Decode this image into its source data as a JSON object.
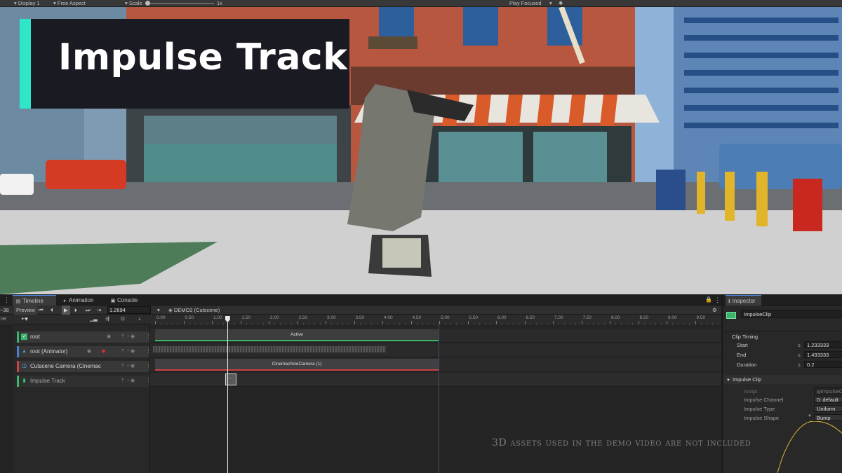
{
  "game_toolbar": {
    "display": "Display 1",
    "aspect": "Free Aspect",
    "scale_label": "Scale",
    "scale_value": "1x",
    "play_mode": "Play Focused"
  },
  "overlay": {
    "title": "Impulse Track",
    "accent_color": "#2fe6c8",
    "watermark": "3D assets used in the demo video are not included"
  },
  "panels": {
    "tabs": [
      {
        "label": "Timeline",
        "icon": "timeline-icon"
      },
      {
        "label": "Animation",
        "icon": "animation-icon"
      },
      {
        "label": "Console",
        "icon": "console-icon"
      }
    ],
    "inspector_tab": "Inspector"
  },
  "timeline": {
    "frame_label": "~38",
    "preview_label": "Preview",
    "current_time": "1.2694",
    "asset_name": "DEMO2 (Cutscene)",
    "playhead_time": 1.2694,
    "ruler_ticks": [
      "0.00",
      "0.50",
      "1.00",
      "1.50",
      "2.00",
      "2.50",
      "3.00",
      "3.50",
      "4.00",
      "4.50",
      "5.00",
      "5.50",
      "6.00",
      "6.50",
      "7.00",
      "7.50",
      "8.00",
      "8.50",
      "9.00",
      "9.50"
    ],
    "tracks": [
      {
        "name": "root",
        "color": "#3bb56b",
        "type": "activation"
      },
      {
        "name": "root (Animator)",
        "color": "#4a7fd1",
        "type": "animation"
      },
      {
        "name": "Cutscene Camera (Cinemac",
        "color": "#c94242",
        "type": "cinemachine"
      },
      {
        "name": "Impulse Track",
        "color": "#3bb56b",
        "type": "impulse"
      }
    ],
    "clips": {
      "active": "Active",
      "camera": "CinemachineCamera (1)"
    }
  },
  "inspector": {
    "object_name": "ImpulseClip",
    "clip_timing_label": "Clip Timing",
    "start_label": "Start",
    "start_unit": "s",
    "start_value": "1.233333",
    "end_label": "End",
    "end_unit": "s",
    "end_value": "1.433333",
    "duration_label": "Duration",
    "duration_unit": "s",
    "duration_value": "0.2",
    "section_label": "Impulse Clip",
    "script_label": "Script",
    "script_value": "ImpulseC",
    "channel_label": "Impulse Channel",
    "channel_value": "0: default",
    "type_label": "Impulse Type",
    "type_value": "Uniform",
    "shape_label": "Impulse Shape",
    "shape_value": "Bump"
  }
}
